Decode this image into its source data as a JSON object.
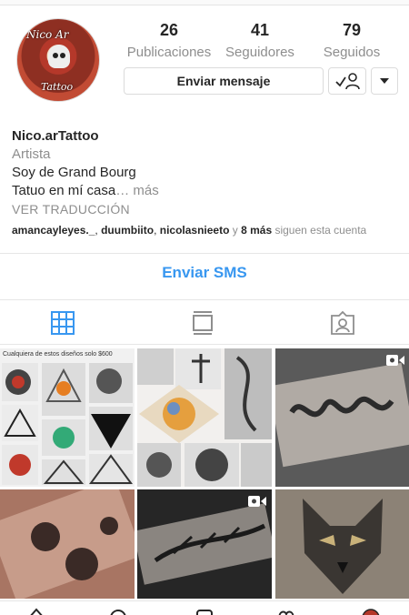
{
  "profile": {
    "stats": [
      {
        "value": "26",
        "label": "Publicaciones"
      },
      {
        "value": "41",
        "label": "Seguidores"
      },
      {
        "value": "79",
        "label": "Seguidos"
      }
    ],
    "message_button": "Enviar mensaje",
    "name": "Nico.arTattoo",
    "category": "Artista",
    "bio_line1": "Soy de Grand Bourg",
    "bio_line2": "Tatuo en mí casa",
    "more_link": "… más",
    "translate": "VER TRADUCCIÓN",
    "followed_by": {
      "user1": "amancayleyes._",
      "sep1": ", ",
      "user2": "duumbiito",
      "sep2": ", ",
      "user3": "nicolasnieeto",
      "sep3": " y ",
      "more": "8 más",
      "suffix": " siguen esta cuenta"
    },
    "logo_text_top": "Nico Ar",
    "logo_text_bottom": "Tattoo"
  },
  "sms_button": "Enviar SMS",
  "tabs": [
    {
      "icon": "grid-icon",
      "active": true
    },
    {
      "icon": "feed-icon",
      "active": false
    },
    {
      "icon": "tagged-icon",
      "active": false
    }
  ],
  "grid": {
    "post1_caption": "Cualquiera de estos diseños solo $600",
    "video_posts": [
      3,
      5
    ]
  },
  "colors": {
    "accent": "#3897f0",
    "secondary_text": "#8e8e8e",
    "border": "#dbdbdb"
  }
}
